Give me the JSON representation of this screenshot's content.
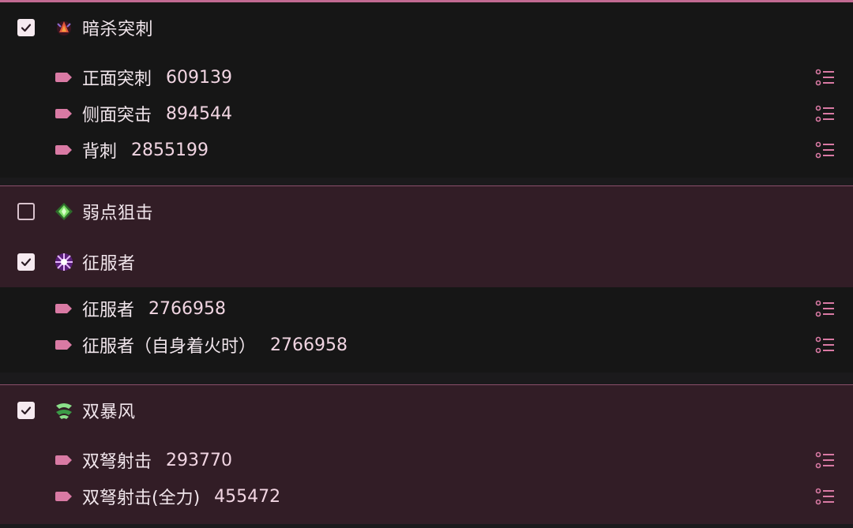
{
  "colors": {
    "accent": "#c26a92",
    "checkbox_fill": "#f6eaf0",
    "dark_bg": "#161616",
    "mauve_bg": "#321d26"
  },
  "groups": [
    {
      "title": "暗杀突刺",
      "checked": true,
      "icon": "assassin-thrust-icon",
      "skills": [
        {
          "name": "正面突刺",
          "value": "609139"
        },
        {
          "name": "侧面突击",
          "value": "894544"
        },
        {
          "name": "背刺",
          "value": "2855199"
        }
      ]
    },
    {
      "title": "弱点狙击",
      "checked": false,
      "icon": "weakpoint-snipe-icon",
      "skills": []
    },
    {
      "title": "征服者",
      "checked": true,
      "icon": "conqueror-icon",
      "skills": [
        {
          "name": "征服者",
          "value": "2766958"
        },
        {
          "name": "征服者（自身着火时）",
          "value": "2766958"
        }
      ]
    },
    {
      "title": "双暴风",
      "checked": true,
      "icon": "twin-storm-icon",
      "skills": [
        {
          "name": "双弩射击",
          "value": "293770"
        },
        {
          "name": "双弩射击(全力)",
          "value": "455472"
        }
      ]
    }
  ]
}
